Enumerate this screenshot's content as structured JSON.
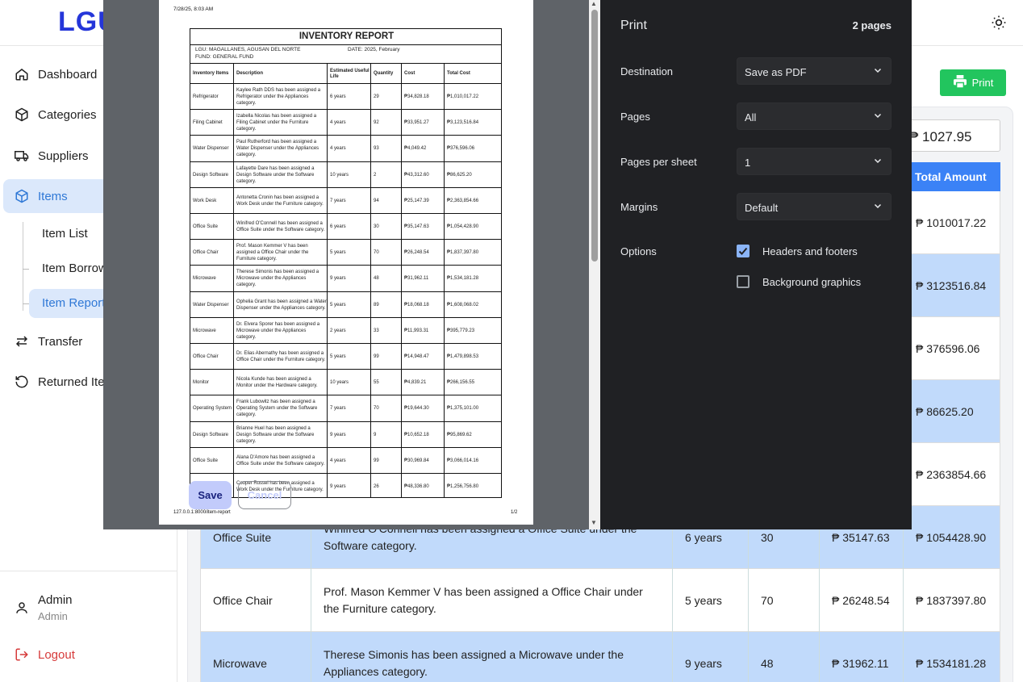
{
  "app": {
    "logo": "LGU",
    "nav": [
      {
        "label": "Dashboard"
      },
      {
        "label": "Categories"
      },
      {
        "label": "Suppliers"
      },
      {
        "label": "Items"
      },
      {
        "label": "Transfer"
      },
      {
        "label": "Returned Items"
      }
    ],
    "subnav": [
      {
        "label": "Item List"
      },
      {
        "label": "Item Borrowed"
      },
      {
        "label": "Item Report"
      }
    ],
    "user": {
      "name": "Admin",
      "role": "Admin"
    },
    "logout": "Logout",
    "print_button": "Print",
    "total_value": "₱ 1027.95",
    "total_header": "Total Amount",
    "rows": [
      {
        "item": "",
        "desc": "",
        "life": "",
        "qty": "",
        "cost": "",
        "total": "₱ 1010017.22",
        "alt": false
      },
      {
        "item": "",
        "desc": "",
        "life": "",
        "qty": "",
        "cost": "",
        "total": "₱ 3123516.84",
        "alt": true
      },
      {
        "item": "",
        "desc": "",
        "life": "",
        "qty": "",
        "cost": "",
        "total": "₱ 376596.06",
        "alt": false
      },
      {
        "item": "",
        "desc": "",
        "life": "",
        "qty": "",
        "cost": "",
        "total": "₱ 86625.20",
        "alt": true
      },
      {
        "item": "",
        "desc": "",
        "life": "",
        "qty": "",
        "cost": "",
        "total": "₱ 2363854.66",
        "alt": false
      },
      {
        "item": "Office Suite",
        "desc": "Winifred O'Connell has been assigned a Office Suite under the Software category.",
        "life": "6 years",
        "qty": "30",
        "cost": "₱ 35147.63",
        "total": "₱ 1054428.90",
        "alt": true
      },
      {
        "item": "Office Chair",
        "desc": "Prof. Mason Kemmer V has been assigned a Office Chair under the Furniture category.",
        "life": "5 years",
        "qty": "70",
        "cost": "₱ 26248.54",
        "total": "₱ 1837397.80",
        "alt": false
      },
      {
        "item": "Microwave",
        "desc": "Therese Simonis has been assigned a Microwave under the Appliances category.",
        "life": "9 years",
        "qty": "48",
        "cost": "₱ 31962.11",
        "total": "₱ 1534181.28",
        "alt": true
      }
    ]
  },
  "preview": {
    "date": "7/28/25, 8:03 AM",
    "url": "127.0.0.1:8000/item-report",
    "page": "1/2",
    "title": "INVENTORY REPORT",
    "lgu": "LGU: MAGALLANES, AGUSAN DEL NORTE",
    "date_line": "DATE: 2025, February",
    "fund": "FUND: GENERAL FUND",
    "headers": [
      "Inventory Items",
      "Description",
      "Estimated Useful Life",
      "Quantity",
      "Cost",
      "Total Cost"
    ],
    "rows": [
      [
        "Refrigerator",
        "Kaylee Rath DDS has been assigned a Refrigerator under the Appliances category.",
        "6 years",
        "29",
        "₱34,828.18",
        "₱1,010,017.22"
      ],
      [
        "Filing Cabinet",
        "Izabella Nicolas has been assigned a Filing Cabinet under the Furniture category.",
        "4 years",
        "92",
        "₱33,951.27",
        "₱3,123,516.84"
      ],
      [
        "Water Dispenser",
        "Paul Rutherford has been assigned a Water Dispenser under the Appliances category.",
        "4 years",
        "93",
        "₱4,049.42",
        "₱376,596.06"
      ],
      [
        "Design Software",
        "Lafayette Dare has been assigned a Design Software under the Software category.",
        "10 years",
        "2",
        "₱43,312.60",
        "₱86,625.20"
      ],
      [
        "Work Desk",
        "Antonetta Cronin has been assigned a Work Desk under the Furniture category.",
        "7 years",
        "94",
        "₱25,147.39",
        "₱2,363,854.66"
      ],
      [
        "Office Suite",
        "Winifred O'Connell has been assigned a Office Suite under the Software category.",
        "6 years",
        "30",
        "₱35,147.63",
        "₱1,054,428.90"
      ],
      [
        "Office Chair",
        "Prof. Mason Kemmer V has been assigned a Office Chair under the Furniture category.",
        "5 years",
        "70",
        "₱26,248.54",
        "₱1,837,397.80"
      ],
      [
        "Microwave",
        "Therese Simonis has been assigned a Microwave under the Appliances category.",
        "9 years",
        "48",
        "₱31,962.11",
        "₱1,534,181.28"
      ],
      [
        "Water Dispenser",
        "Ophelia Grant has been assigned a Water Dispenser under the Appliances category.",
        "5 years",
        "89",
        "₱18,068.18",
        "₱1,608,068.02"
      ],
      [
        "Microwave",
        "Dr. Elvera Sporer has been assigned a Microwave under the Appliances category.",
        "2 years",
        "33",
        "₱11,993.31",
        "₱395,779.23"
      ],
      [
        "Office Chair",
        "Dr. Elias Abernathy has been assigned a Office Chair under the Furniture category.",
        "5 years",
        "99",
        "₱14,948.47",
        "₱1,479,898.53"
      ],
      [
        "Monitor",
        "Nicola Kunde has been assigned a Monitor under the Hardware category.",
        "10 years",
        "55",
        "₱4,839.21",
        "₱266,156.55"
      ],
      [
        "Operating System",
        "Frank Lubowitz has been assigned a Operating System under the Software category.",
        "7 years",
        "70",
        "₱19,644.30",
        "₱1,375,101.00"
      ],
      [
        "Design Software",
        "Brianne Huel has been assigned a Design Software under the Software category.",
        "9 years",
        "9",
        "₱10,652.18",
        "₱95,869.62"
      ],
      [
        "Office Suite",
        "Alana D'Amore has been assigned a Office Suite under the Software category.",
        "4 years",
        "99",
        "₱30,969.84",
        "₱3,066,014.16"
      ],
      [
        "Work Desk",
        "Cooper Russel has been assigned a Work Desk under the Furniture category.",
        "9 years",
        "26",
        "₱48,336.80",
        "₱1,256,756.80"
      ]
    ]
  },
  "print_dialog": {
    "title": "Print",
    "page_count": "2 pages",
    "destination_label": "Destination",
    "destination_value": "Save as PDF",
    "pages_label": "Pages",
    "pages_value": "All",
    "pps_label": "Pages per sheet",
    "pps_value": "1",
    "margins_label": "Margins",
    "margins_value": "Default",
    "options_label": "Options",
    "headers_footers": "Headers and footers",
    "background_graphics": "Background graphics",
    "save": "Save",
    "cancel": "Cancel"
  },
  "colors": {
    "accent": "#3b82f6",
    "print_green": "#22c55e",
    "dialog_bg": "#202124",
    "save_bg": "#c2cbfb"
  }
}
